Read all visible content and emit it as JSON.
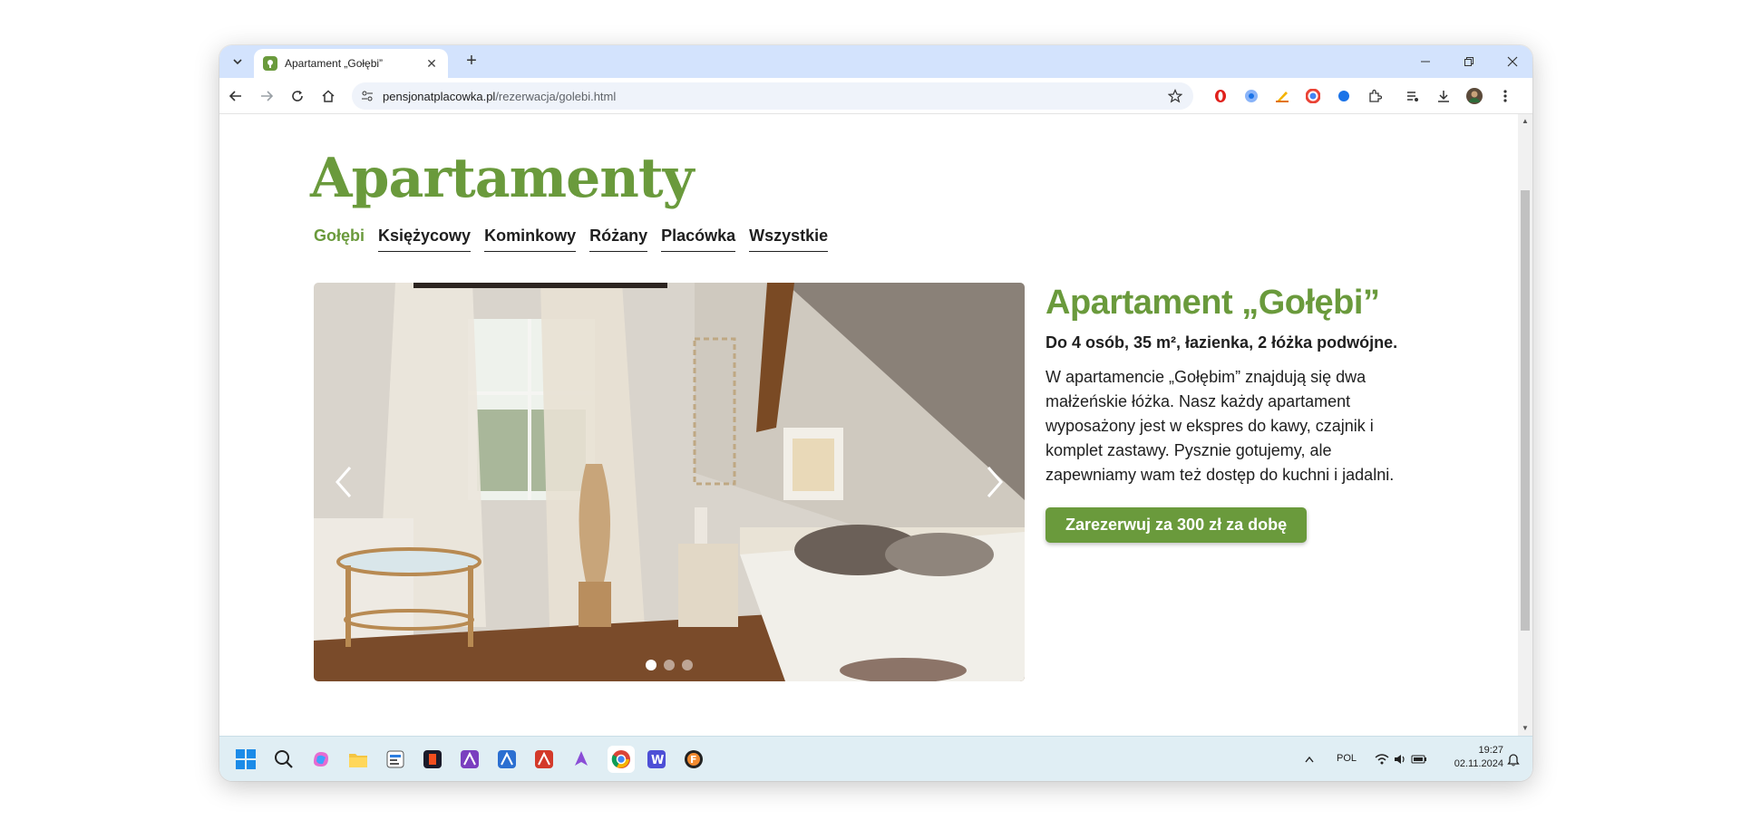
{
  "browser": {
    "tab_title": "Apartament „Gołębi”",
    "url_host": "pensjonatplacowka.pl",
    "url_path": "/rezerwacja/golebi.html"
  },
  "page": {
    "site_title": "Apartamenty",
    "nav": [
      {
        "label": "Gołębi",
        "active": true
      },
      {
        "label": "Księżycowy",
        "active": false
      },
      {
        "label": "Kominkowy",
        "active": false
      },
      {
        "label": "Różany",
        "active": false
      },
      {
        "label": "Placówka",
        "active": false
      },
      {
        "label": "Wszystkie",
        "active": false
      }
    ],
    "carousel": {
      "slides": 3,
      "active_index": 0
    },
    "apartment_title": "Apartament „Gołębi”",
    "specs": "Do 4 osób, 35 m², łazienka, 2 łóżka podwójne.",
    "description": "W apartamencie „Gołębim” znajdują się dwa małżeńskie łóżka. Nasz każdy apartament wyposażony jest w ekspres do kawy, czajnik i komplet zastawy. Pysznie gotujemy, ale zapewniamy wam też dostęp do kuchni i jadalni.",
    "book_button": "Zarezerwuj za 300 zł za dobę"
  },
  "taskbar": {
    "language": "POL",
    "time": "19:27",
    "date": "02.11.2024"
  },
  "colors": {
    "brand_green": "#6a9a3c",
    "tab_strip": "#d3e3fd",
    "taskbar": "#e0eef4"
  }
}
